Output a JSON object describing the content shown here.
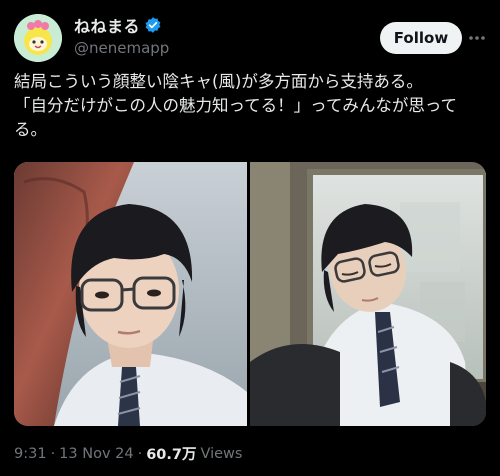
{
  "author": {
    "display_name": "ねねまる",
    "handle": "@nenemapp",
    "verified": true,
    "avatar_icon": "cartoon-character-avatar"
  },
  "actions": {
    "follow_label": "Follow",
    "more_icon": "more-dots-icon"
  },
  "post": {
    "text": "結局こういう顔整い陰キャ(風)が多方面から支持ある。\n「自分だけがこの人の魅力知ってる！」ってみんなが思ってる。"
  },
  "meta": {
    "time": "9:31",
    "date": "13 Nov 24",
    "views_count": "60.7万",
    "views_label": "Views",
    "separator": "·"
  },
  "colors": {
    "background": "#000000",
    "text": "#e7e9ea",
    "secondary_text": "#71767b",
    "verified_badge": "#1d9bf0",
    "follow_button_bg": "#eff3f4"
  }
}
